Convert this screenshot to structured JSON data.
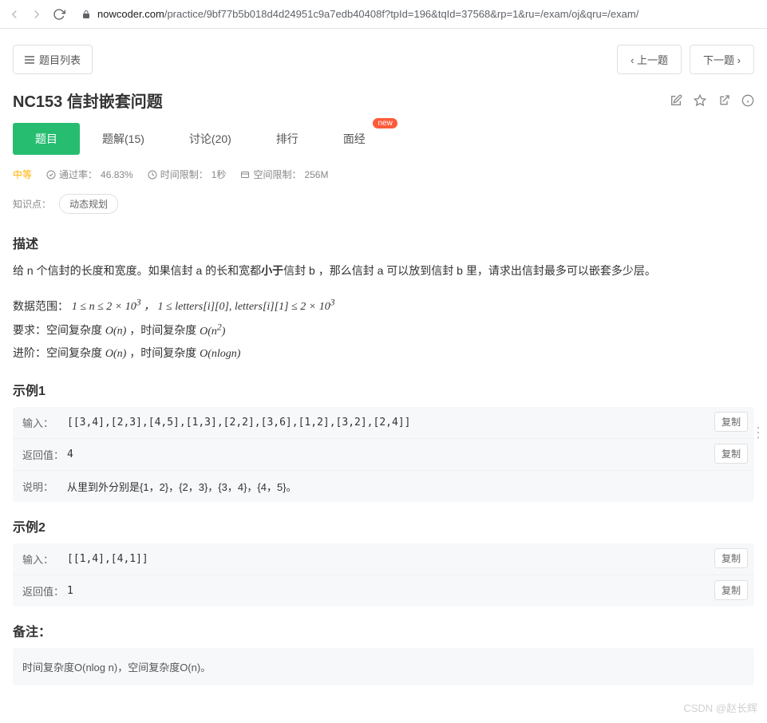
{
  "browser": {
    "url_host": "nowcoder.com",
    "url_path": "/practice/9bf77b5b018d4d24951c9a7edb40408f?tpId=196&tqId=37568&rp=1&ru=/exam/oj&qru=/exam/"
  },
  "nav": {
    "list_button": "题目列表",
    "prev": "上一题",
    "next": "下一题"
  },
  "title": "NC153  信封嵌套问题",
  "tabs": [
    {
      "label": "题目",
      "active": true
    },
    {
      "label": "题解(15)"
    },
    {
      "label": "讨论(20)"
    },
    {
      "label": "排行"
    },
    {
      "label": "面经",
      "badge": "new"
    }
  ],
  "stats": {
    "difficulty": "中等",
    "pass_rate_label": "通过率：",
    "pass_rate": "46.83%",
    "time_limit_label": "时间限制：",
    "time_limit": "1秒",
    "space_limit_label": "空间限制：",
    "space_limit": "256M"
  },
  "tags": {
    "label": "知识点：",
    "items": [
      "动态规划"
    ]
  },
  "sections": {
    "desc_h": "描述",
    "ex1_h": "示例1",
    "ex2_h": "示例2",
    "note_h": "备注："
  },
  "description": {
    "p1_a": "给 n 个信封的长度和宽度。如果信封 a 的长和宽都",
    "p1_bold": "小于",
    "p1_b": "信封 b ，那么信封 a 可以放到信封 b 里，请求出信封最多可以嵌套多少层。",
    "range_label": "数据范围：",
    "range_formula": "1 ≤ n ≤ 2 × 10³ ， 1 ≤ letters[i][0], letters[i][1] ≤ 2 × 10³",
    "req_label": "要求：空间复杂度 ",
    "req_space": "O(n)",
    "req_mid": " ，时间复杂度 ",
    "req_time": "O(n²)",
    "adv_label": "进阶：空间复杂度 ",
    "adv_space": "O(n)",
    "adv_mid": " ，时间复杂度 ",
    "adv_time": "O(nlogn)"
  },
  "labels": {
    "input": "输入：",
    "output": "返回值：",
    "explain": "说明：",
    "copy": "复制"
  },
  "example1": {
    "input": "[[3,4],[2,3],[4,5],[1,3],[2,2],[3,6],[1,2],[3,2],[2,4]]",
    "output": "4",
    "explain": "从里到外分别是{1，2}，{2，3}，{3，4}，{4，5}。"
  },
  "example2": {
    "input": "[[1,4],[4,1]]",
    "output": "1"
  },
  "note": "时间复杂度O(nlog n)，空间复杂度O(n)。",
  "watermark": "CSDN @赵长辉"
}
